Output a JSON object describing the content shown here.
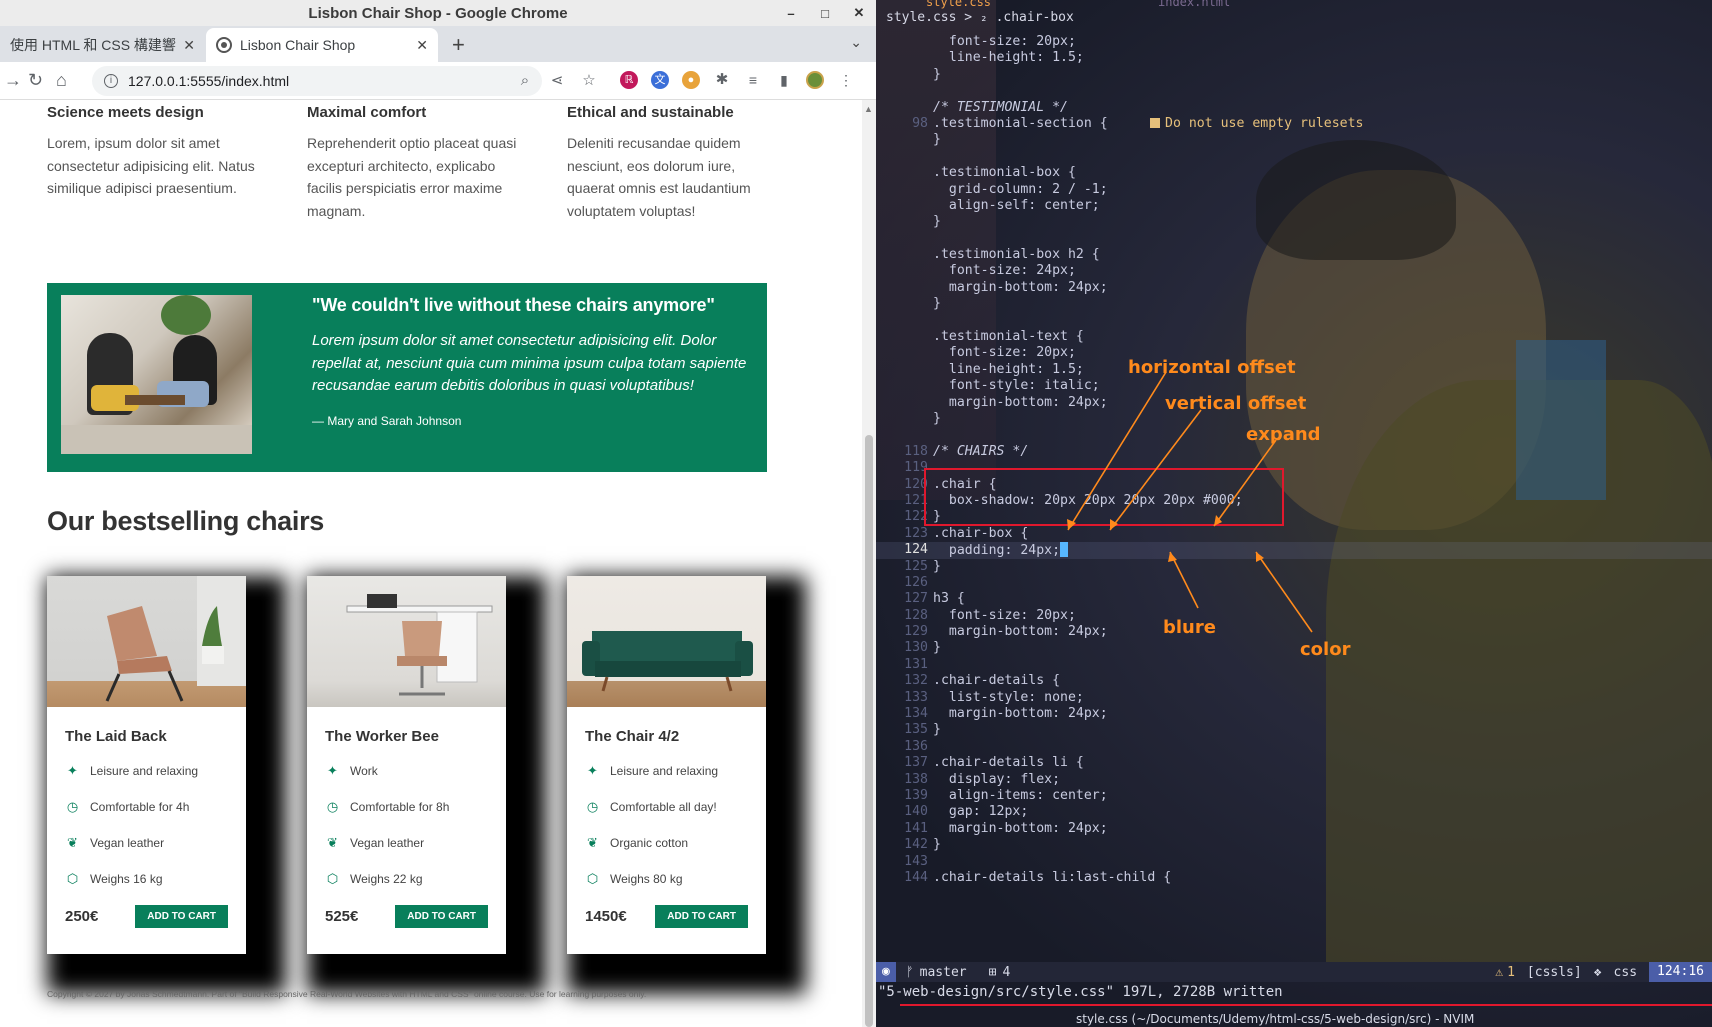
{
  "chrome": {
    "window_title": "Lisbon Chair Shop - Google Chrome",
    "tabs": [
      {
        "label": "使用 HTML 和 CSS 構建響"
      },
      {
        "label": "Lisbon Chair Shop"
      }
    ],
    "new_tab": "+",
    "url": "127.0.0.1:5555/index.html",
    "win_controls": [
      "–",
      "□",
      "✕"
    ]
  },
  "page": {
    "features": [
      {
        "title": "Science meets design",
        "text": "Lorem, ipsum dolor sit amet consectetur adipisicing elit. Natus similique adipisci praesentium."
      },
      {
        "title": "Maximal comfort",
        "text": "Reprehenderit optio placeat quasi excepturi architecto, explicabo facilis perspiciatis error maxime magnam."
      },
      {
        "title": "Ethical and sustainable",
        "text": "Deleniti recusandae quidem nesciunt, eos dolorum iure, quaerat omnis est laudantium voluptatem voluptas!"
      }
    ],
    "testimonial": {
      "title": "\"We couldn't live without these chairs anymore\"",
      "text": "Lorem ipsum dolor sit amet consectetur adipisicing elit. Dolor repellat at, nesciunt quia cum minima ipsum culpa totam sapiente recusandae earum debitis doloribus in quasi voluptatibus!",
      "author": "— Mary and Sarah Johnson"
    },
    "bestselling_title": "Our bestselling chairs",
    "chairs": [
      {
        "name": "The Laid Back",
        "details": [
          "Leisure and relaxing",
          "Comfortable for 4h",
          "Vegan leather",
          "Weighs 16 kg"
        ],
        "price": "250€",
        "button": "ADD TO CART"
      },
      {
        "name": "The Worker Bee",
        "details": [
          "Work",
          "Comfortable for 8h",
          "Vegan leather",
          "Weighs 22 kg"
        ],
        "price": "525€",
        "button": "ADD TO CART"
      },
      {
        "name": "The Chair 4/2",
        "details": [
          "Leisure and relaxing",
          "Comfortable all day!",
          "Organic cotton",
          "Weighs 80 kg"
        ],
        "price": "1450€",
        "button": "ADD TO CART"
      }
    ],
    "detail_icons": [
      "sparkles-icon",
      "clock-icon",
      "leaf-icon",
      "cube-icon"
    ],
    "copyright": "Copyright © 2027 by Jonas Schmedtmann. Part of \"Build Responsive Real-World Websites with HTML and CSS\" online course. Use for learning purposes only."
  },
  "editor": {
    "tabs": [
      "style.css",
      "index.html"
    ],
    "breadcrumb": "style.css > ₂ .chair-box",
    "lint_message": "Do not use empty rulesets",
    "lines": [
      {
        "n": "",
        "code": "  font-size: 20px;"
      },
      {
        "n": "",
        "code": "  line-height: 1.5;"
      },
      {
        "n": "",
        "code": "}"
      },
      {
        "n": "",
        "code": ""
      },
      {
        "n": "",
        "code": "/* TESTIMONIAL */"
      },
      {
        "n": "98",
        "code": ".testimonial-section {"
      },
      {
        "n": "",
        "code": "}"
      },
      {
        "n": "",
        "code": ""
      },
      {
        "n": "",
        "code": ".testimonial-box {"
      },
      {
        "n": "",
        "code": "  grid-column: 2 / -1;"
      },
      {
        "n": "",
        "code": "  align-self: center;"
      },
      {
        "n": "",
        "code": "}"
      },
      {
        "n": "",
        "code": ""
      },
      {
        "n": "",
        "code": ".testimonial-box h2 {"
      },
      {
        "n": "",
        "code": "  font-size: 24px;"
      },
      {
        "n": "",
        "code": "  margin-bottom: 24px;"
      },
      {
        "n": "",
        "code": "}"
      },
      {
        "n": "",
        "code": ""
      },
      {
        "n": "",
        "code": ".testimonial-text {"
      },
      {
        "n": "",
        "code": "  font-size: 20px;"
      },
      {
        "n": "",
        "code": "  line-height: 1.5;"
      },
      {
        "n": "",
        "code": "  font-style: italic;"
      },
      {
        "n": "",
        "code": "  margin-bottom: 24px;"
      },
      {
        "n": "",
        "code": "}"
      },
      {
        "n": "",
        "code": ""
      },
      {
        "n": "118",
        "code": "/* CHAIRS */"
      },
      {
        "n": "119",
        "code": ""
      },
      {
        "n": "120",
        "code": ".chair {"
      },
      {
        "n": "121",
        "code": "  box-shadow: 20px 20px 20px 20px #000;"
      },
      {
        "n": "122",
        "code": "}"
      },
      {
        "n": "123",
        "code": ".chair-box {"
      },
      {
        "n": "124",
        "code": "  padding: 24px;"
      },
      {
        "n": "125",
        "code": "}"
      },
      {
        "n": "126",
        "code": ""
      },
      {
        "n": "127",
        "code": "h3 {"
      },
      {
        "n": "128",
        "code": "  font-size: 20px;"
      },
      {
        "n": "129",
        "code": "  margin-bottom: 24px;"
      },
      {
        "n": "130",
        "code": "}"
      },
      {
        "n": "131",
        "code": ""
      },
      {
        "n": "132",
        "code": ".chair-details {"
      },
      {
        "n": "133",
        "code": "  list-style: none;"
      },
      {
        "n": "134",
        "code": "  margin-bottom: 24px;"
      },
      {
        "n": "135",
        "code": "}"
      },
      {
        "n": "136",
        "code": ""
      },
      {
        "n": "137",
        "code": ".chair-details li {"
      },
      {
        "n": "138",
        "code": "  display: flex;"
      },
      {
        "n": "139",
        "code": "  align-items: center;"
      },
      {
        "n": "140",
        "code": "  gap: 12px;"
      },
      {
        "n": "141",
        "code": "  margin-bottom: 24px;"
      },
      {
        "n": "142",
        "code": "}"
      },
      {
        "n": "143",
        "code": ""
      },
      {
        "n": "144",
        "code": ".chair-details li:last-child {"
      }
    ],
    "annotations": {
      "horizontal": "horizontal offset",
      "vertical": "vertical offset",
      "expand": "expand",
      "blur": "blure",
      "color": "color"
    },
    "status": {
      "branch": "master",
      "changes": "4",
      "warnings": "1",
      "linter": "[cssls]",
      "filetype": "css",
      "position": "124:16"
    },
    "cmdline": "\"5-web-design/src/style.css\" 197L, 2728B written",
    "bottom_title": "style.css (~/Documents/Udemy/html-css/5-web-design/src) - NVIM"
  }
}
